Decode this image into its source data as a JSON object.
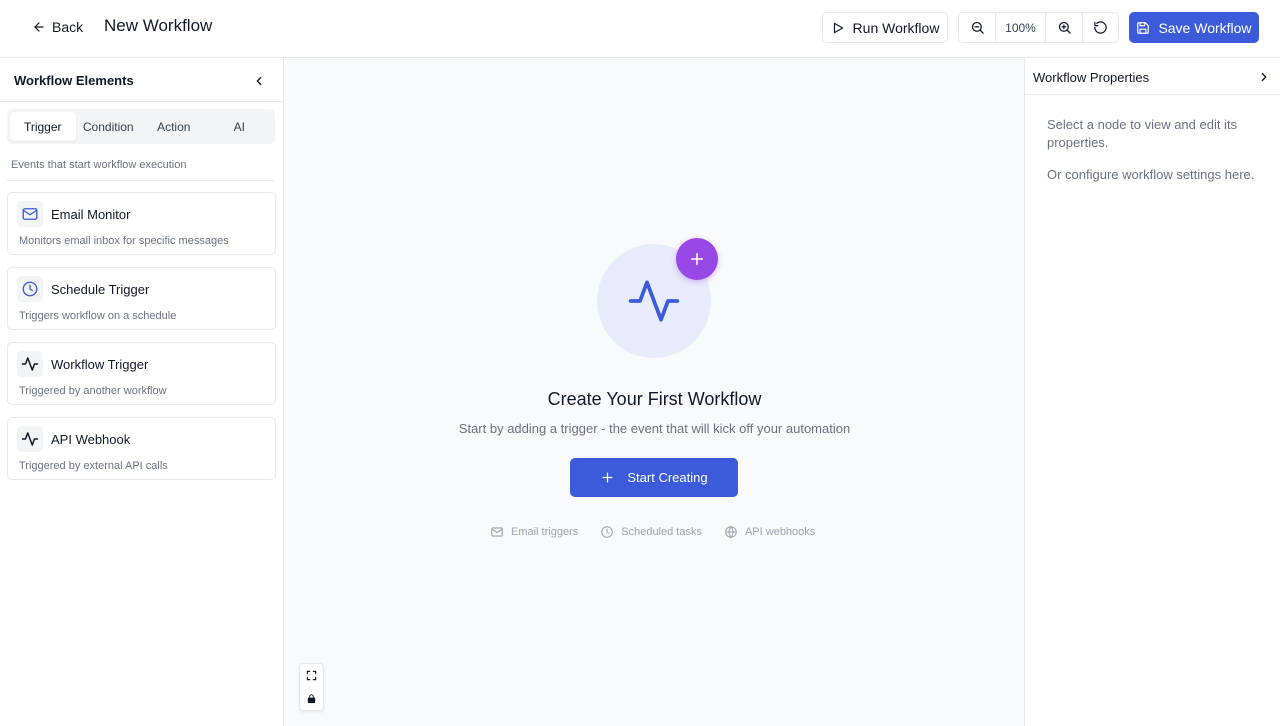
{
  "header": {
    "back_label": "Back",
    "title": "New Workflow",
    "run_label": "Run Workflow",
    "zoom_level": "100%",
    "save_label": "Save Workflow"
  },
  "left_panel": {
    "title": "Workflow Elements",
    "tabs": [
      {
        "label": "Trigger",
        "active": true
      },
      {
        "label": "Condition",
        "active": false
      },
      {
        "label": "Action",
        "active": false
      },
      {
        "label": "AI",
        "active": false
      }
    ],
    "tab_description": "Events that start workflow execution",
    "items": [
      {
        "title": "Email Monitor",
        "description": "Monitors email inbox for specific messages",
        "icon": "mail-icon"
      },
      {
        "title": "Schedule Trigger",
        "description": "Triggers workflow on a schedule",
        "icon": "clock-icon"
      },
      {
        "title": "Workflow Trigger",
        "description": "Triggered by another workflow",
        "icon": "activity-icon"
      },
      {
        "title": "API Webhook",
        "description": "Triggered by external API calls",
        "icon": "activity-icon"
      }
    ]
  },
  "canvas": {
    "empty_title": "Create Your First Workflow",
    "empty_subtitle": "Start by adding a trigger - the event that will kick off your automation",
    "start_label": "Start Creating",
    "hints": [
      {
        "label": "Email triggers",
        "icon": "mail-icon"
      },
      {
        "label": "Scheduled tasks",
        "icon": "clock-icon"
      },
      {
        "label": "API webhooks",
        "icon": "globe-icon"
      }
    ]
  },
  "right_panel": {
    "title": "Workflow Properties",
    "line1": "Select a node to view and edit its properties.",
    "line2": "Or configure workflow settings here."
  },
  "colors": {
    "primary": "#3b5bdb",
    "accent_purple": "#9848e6",
    "hero_bg": "#e8ebfb",
    "border": "#e5e7eb",
    "muted_text": "#6b7280"
  }
}
